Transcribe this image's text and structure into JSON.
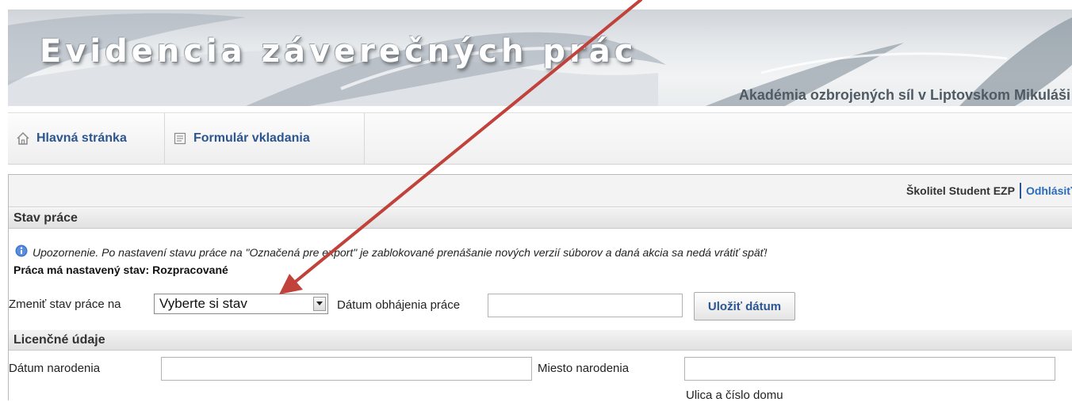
{
  "header": {
    "app_title": "Evidencia záverečných prác",
    "organization": "Akadémia ozbrojených síl v Liptovskom Mikuláši"
  },
  "nav": {
    "items": [
      {
        "label": "Hlavná stránka",
        "icon": "home-icon"
      },
      {
        "label": "Formulár vkladania",
        "icon": "document-icon"
      }
    ]
  },
  "user": {
    "name": "Školitel Student EZP",
    "logout_label": "Odhlásiť"
  },
  "status_section": {
    "title": "Stav práce",
    "notice": "Upozornenie. Po nastavení stavu práce na \"Označená pre export\" je zablokované prenášanie nových verzií súborov a daná akcia sa nedá vrátiť späť!",
    "current_state_line": "Práca má nastavený stav: Rozpracované",
    "change_label": "Zmeniť stav práce na",
    "select_value": "Vyberte si stav",
    "defense_date_label": "Dátum obhájenia práce",
    "defense_date_value": "",
    "save_date_label": "Uložiť dátum"
  },
  "license_section": {
    "title": "Licenčné údaje",
    "birth_date_label": "Dátum narodenia",
    "birth_date_value": "",
    "birth_place_label": "Miesto narodenia",
    "birth_place_value": "",
    "street_label": "Ulica a číslo domu"
  },
  "colors": {
    "link": "#2b5691",
    "annotation_arrow": "#c0423a",
    "info_icon": "#3d73c9"
  }
}
